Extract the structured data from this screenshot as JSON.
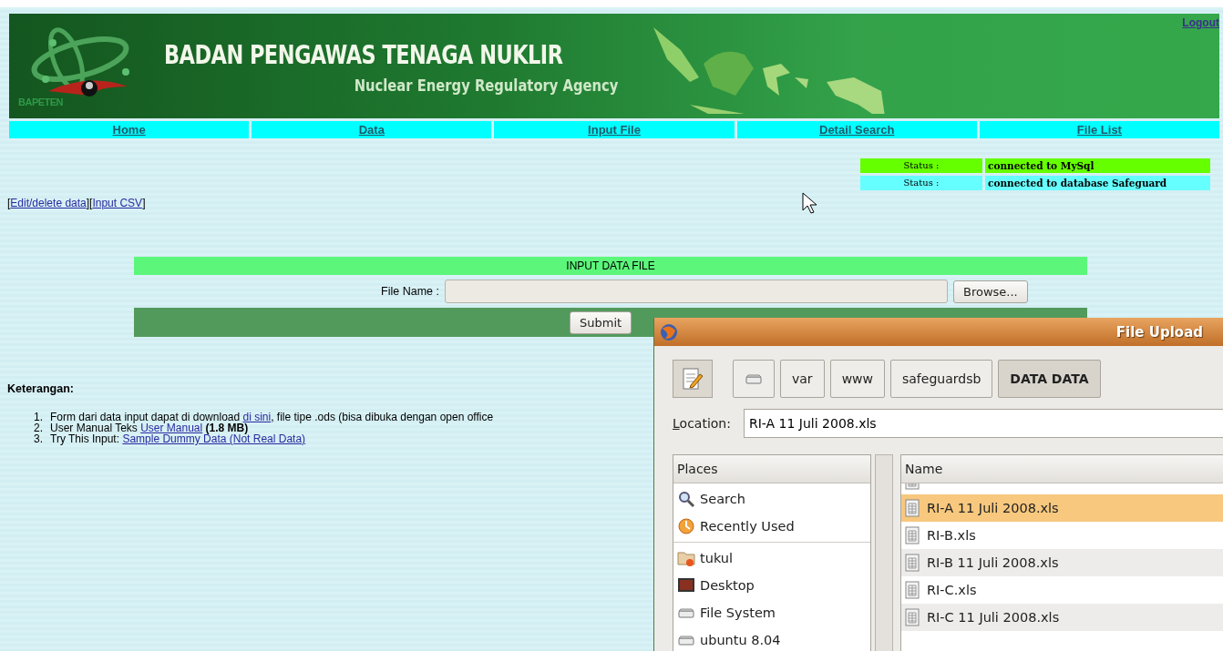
{
  "header": {
    "logo_text": "BAPETEN",
    "title": "BADAN PENGAWAS TENAGA NUKLIR",
    "subtitle": "Nuclear Energy Regulatory Agency",
    "logout": "Logout"
  },
  "nav": [
    "Home",
    "Data",
    "Input File",
    "Detail Search",
    "File List"
  ],
  "status": [
    {
      "label": "Status :",
      "value": "connected to MySql",
      "color": "#66ff00"
    },
    {
      "label": "Status :",
      "value": "connected to database Safeguard",
      "color": "#66ffff"
    }
  ],
  "links_line": [
    {
      "kind": "text",
      "text": "["
    },
    {
      "kind": "link",
      "text": "Edit/delete data"
    },
    {
      "kind": "text",
      "text": "]["
    },
    {
      "kind": "link",
      "text": "Input CSV"
    },
    {
      "kind": "text",
      "text": "]"
    }
  ],
  "form": {
    "title": "INPUT DATA FILE",
    "file_label": "File Name :",
    "browse": "Browse...",
    "submit": "Submit"
  },
  "notes": {
    "heading": "Keterangan:",
    "items": [
      {
        "number": "1.",
        "parts": [
          {
            "kind": "text",
            "text": "Form dari data input dapat di download "
          },
          {
            "kind": "link",
            "text": "di sini"
          },
          {
            "kind": "text",
            "text": ", file tipe .ods (bisa dibuka dengan open office"
          }
        ]
      },
      {
        "number": "2.",
        "parts": [
          {
            "kind": "text",
            "text": "User Manual Teks "
          },
          {
            "kind": "link",
            "text": "User Manual"
          },
          {
            "kind": "bold",
            "text": " (1.8 MB)"
          }
        ]
      },
      {
        "number": "3.",
        "parts": [
          {
            "kind": "text",
            "text": "Try This Input: "
          },
          {
            "kind": "link",
            "text": "Sample Dummy Data (Not Real Data)"
          }
        ]
      }
    ]
  },
  "dialog": {
    "title": "File Upload",
    "path_buttons": [
      {
        "kind": "drive",
        "selected": false
      },
      {
        "kind": "folder",
        "label": "var",
        "selected": false
      },
      {
        "kind": "folder",
        "label": "www",
        "selected": false
      },
      {
        "kind": "folder",
        "label": "safeguardsb",
        "selected": false
      },
      {
        "kind": "folder",
        "label": "DATA DATA",
        "selected": true
      }
    ],
    "location_label": "Location:",
    "location_value": "RI-A 11 Juli 2008.xls",
    "places_header": "Places",
    "places": [
      [
        {
          "kind": "search",
          "label": "Search"
        },
        {
          "kind": "recent",
          "label": "Recently Used"
        }
      ],
      [
        {
          "kind": "home",
          "label": "tukul"
        },
        {
          "kind": "desktop",
          "label": "Desktop"
        },
        {
          "kind": "drive",
          "label": "File System"
        },
        {
          "kind": "drive",
          "label": "ubuntu 8.04"
        }
      ]
    ],
    "files_header": "Name",
    "files": [
      {
        "selected": false
      },
      {
        "name": "RI-A 11 Juli 2008.xls",
        "selected": true
      },
      {
        "name": "RI-B.xls",
        "selected": false
      },
      {
        "name": "RI-B 11 Juli 2008.xls",
        "selected": false
      },
      {
        "name": "RI-C.xls",
        "selected": false
      },
      {
        "name": "RI-C 11 Juli 2008.xls",
        "selected": false
      }
    ]
  }
}
